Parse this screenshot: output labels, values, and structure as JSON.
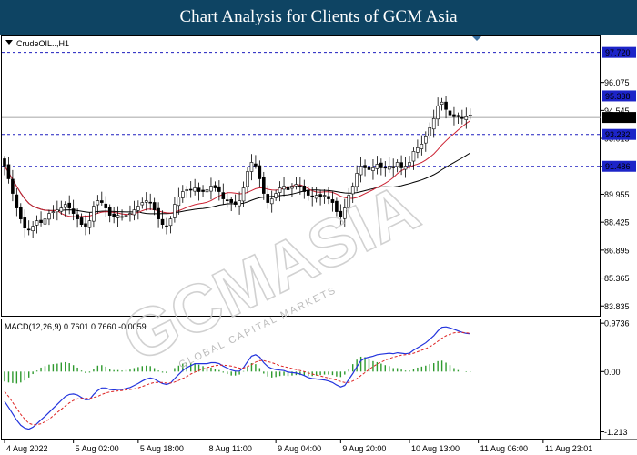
{
  "banner": {
    "title": "Chart Analysis for Clients of GCM Asia"
  },
  "watermark": {
    "main": "GCMASIA",
    "sub": "GLOBAL CAPITAL MARKETS"
  },
  "chart_data": [
    {
      "type": "candlestick",
      "title": "CrudeOIL..,H1",
      "colors": {
        "up": "#ffffff",
        "down": "#000000",
        "wick": "#000000",
        "ma_fast": "#cc2233",
        "ma_slow": "#000000",
        "level_line": "#1f1fbf",
        "price_line": "#888888"
      },
      "ylim": [
        83.3,
        98.6
      ],
      "price_ticks": [
        "96.075",
        "94.545",
        "93.015",
        "91.485",
        "89.955",
        "88.425",
        "86.895",
        "85.365",
        "83.835"
      ],
      "horizontal_levels": [
        "97.720",
        "95.338",
        "93.232",
        "91.486"
      ],
      "current_price": "94.160",
      "x_ticks": [
        "4 Aug 2022",
        "5 Aug 02:00",
        "5 Aug 18:00",
        "8 Aug 11:00",
        "9 Aug 04:00",
        "9 Aug 20:00",
        "10 Aug 13:00",
        "11 Aug 06:00",
        "11 Aug 23:01"
      ],
      "x_tick_index": [
        0,
        17,
        33,
        50,
        67,
        83,
        100,
        117,
        133
      ],
      "close": [
        91.5,
        90.8,
        90.0,
        89.2,
        88.6,
        88.1,
        88.0,
        88.2,
        88.5,
        88.4,
        88.6,
        88.9,
        89.0,
        89.1,
        89.2,
        89.4,
        89.2,
        88.9,
        88.6,
        88.3,
        88.2,
        88.5,
        89.3,
        89.6,
        89.5,
        89.2,
        88.8,
        88.7,
        88.8,
        88.7,
        88.8,
        88.9,
        89.1,
        89.3,
        89.5,
        89.6,
        89.5,
        89.1,
        88.6,
        88.3,
        88.2,
        88.6,
        89.4,
        89.8,
        90.1,
        90.2,
        90.2,
        90.3,
        90.1,
        90.1,
        90.2,
        90.4,
        90.3,
        90.1,
        89.7,
        89.6,
        89.5,
        89.4,
        89.6,
        90.3,
        91.2,
        91.7,
        91.5,
        90.8,
        90.0,
        89.5,
        89.7,
        90.0,
        90.3,
        90.4,
        90.2,
        90.4,
        90.5,
        90.4,
        90.1,
        89.9,
        89.8,
        89.9,
        89.8,
        89.9,
        89.7,
        89.5,
        89.0,
        88.7,
        89.2,
        89.9,
        90.4,
        91.1,
        91.5,
        91.4,
        91.3,
        91.4,
        91.6,
        91.4,
        91.4,
        91.5,
        91.4,
        91.7,
        91.4,
        91.5,
        91.7,
        92.3,
        92.5,
        92.7,
        93.1,
        93.6,
        94.1,
        94.8,
        95.0,
        94.6,
        94.3,
        94.2,
        94.2,
        94.1,
        94.2,
        94.3
      ],
      "indicator": {
        "name": "MACD(12,26,9) 0.7601 0.7660 -0.0059",
        "ylim": [
          -1.35,
          1.05
        ],
        "ticks": [
          "0.9736",
          "0.00",
          "-1.213"
        ],
        "macd": [
          -0.6,
          -0.72,
          -0.85,
          -0.98,
          -1.08,
          -1.14,
          -1.16,
          -1.12,
          -1.05,
          -0.97,
          -0.9,
          -0.82,
          -0.74,
          -0.66,
          -0.58,
          -0.5,
          -0.46,
          -0.45,
          -0.47,
          -0.52,
          -0.57,
          -0.56,
          -0.46,
          -0.38,
          -0.33,
          -0.33,
          -0.36,
          -0.37,
          -0.36,
          -0.36,
          -0.34,
          -0.32,
          -0.28,
          -0.24,
          -0.19,
          -0.15,
          -0.13,
          -0.15,
          -0.2,
          -0.24,
          -0.26,
          -0.23,
          -0.14,
          -0.06,
          0.02,
          0.08,
          0.12,
          0.16,
          0.16,
          0.16,
          0.16,
          0.18,
          0.18,
          0.16,
          0.11,
          0.07,
          0.03,
          0.01,
          0.01,
          0.08,
          0.2,
          0.31,
          0.34,
          0.29,
          0.18,
          0.1,
          0.06,
          0.04,
          0.03,
          0.02,
          -0.01,
          -0.02,
          -0.03,
          -0.05,
          -0.08,
          -0.12,
          -0.14,
          -0.15,
          -0.16,
          -0.17,
          -0.19,
          -0.22,
          -0.27,
          -0.31,
          -0.28,
          -0.16,
          -0.04,
          0.1,
          0.22,
          0.27,
          0.29,
          0.31,
          0.34,
          0.35,
          0.36,
          0.37,
          0.36,
          0.38,
          0.37,
          0.36,
          0.37,
          0.43,
          0.48,
          0.53,
          0.58,
          0.65,
          0.72,
          0.82,
          0.89,
          0.9,
          0.88,
          0.85,
          0.82,
          0.79,
          0.77,
          0.76
        ],
        "signal": [
          -0.4,
          -0.5,
          -0.62,
          -0.74,
          -0.86,
          -0.96,
          -1.04,
          -1.07,
          -1.07,
          -1.05,
          -1.01,
          -0.96,
          -0.89,
          -0.82,
          -0.76,
          -0.69,
          -0.63,
          -0.58,
          -0.55,
          -0.54,
          -0.54,
          -0.54,
          -0.52,
          -0.5,
          -0.46,
          -0.43,
          -0.41,
          -0.4,
          -0.39,
          -0.38,
          -0.37,
          -0.36,
          -0.35,
          -0.33,
          -0.3,
          -0.27,
          -0.24,
          -0.22,
          -0.22,
          -0.22,
          -0.23,
          -0.23,
          -0.21,
          -0.18,
          -0.14,
          -0.1,
          -0.05,
          -0.01,
          0.02,
          0.05,
          0.08,
          0.1,
          0.12,
          0.13,
          0.13,
          0.12,
          0.11,
          0.09,
          0.07,
          0.07,
          0.1,
          0.14,
          0.19,
          0.22,
          0.22,
          0.2,
          0.18,
          0.15,
          0.12,
          0.1,
          0.08,
          0.06,
          0.04,
          0.02,
          0.0,
          -0.03,
          -0.05,
          -0.07,
          -0.09,
          -0.11,
          -0.13,
          -0.15,
          -0.17,
          -0.2,
          -0.22,
          -0.22,
          -0.19,
          -0.14,
          -0.08,
          -0.02,
          0.04,
          0.1,
          0.15,
          0.19,
          0.23,
          0.26,
          0.29,
          0.31,
          0.33,
          0.34,
          0.35,
          0.37,
          0.4,
          0.43,
          0.46,
          0.5,
          0.55,
          0.61,
          0.67,
          0.72,
          0.75,
          0.78,
          0.79,
          0.79,
          0.78,
          0.77
        ]
      }
    }
  ]
}
